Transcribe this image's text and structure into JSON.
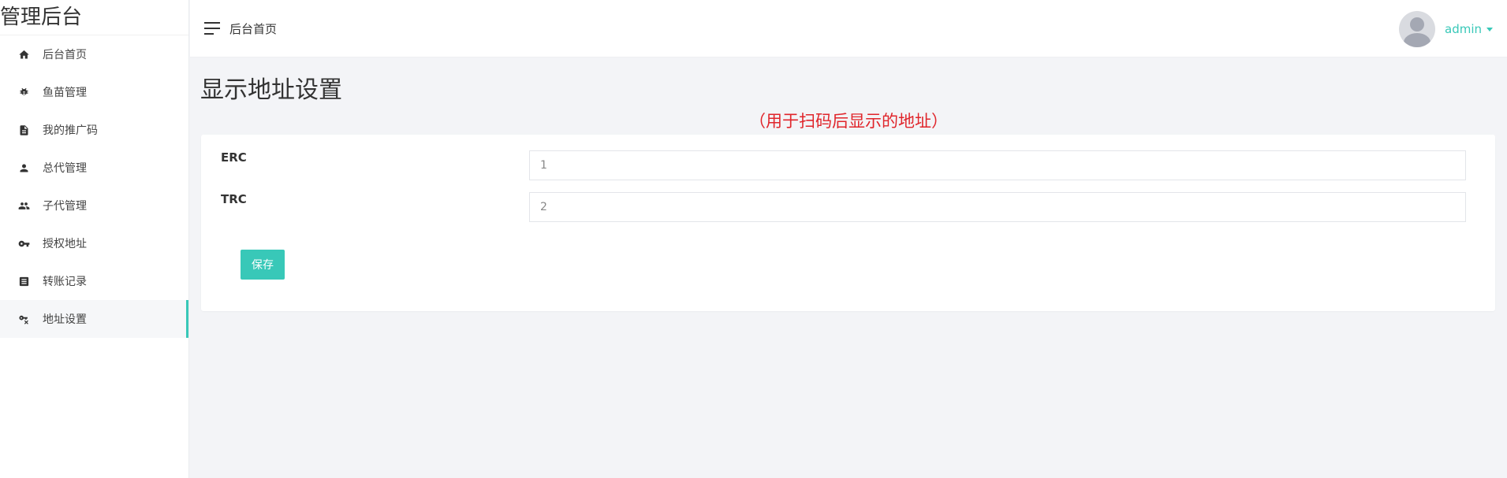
{
  "app": {
    "title": "管理后台"
  },
  "sidebar": {
    "items": [
      {
        "label": "后台首页",
        "icon": "home-icon"
      },
      {
        "label": "鱼苗管理",
        "icon": "bug-icon"
      },
      {
        "label": "我的推广码",
        "icon": "document-icon"
      },
      {
        "label": "总代管理",
        "icon": "person-icon"
      },
      {
        "label": "子代管理",
        "icon": "people-icon"
      },
      {
        "label": "授权地址",
        "icon": "key-icon"
      },
      {
        "label": "转账记录",
        "icon": "list-icon"
      },
      {
        "label": "地址设置",
        "icon": "key-off-icon",
        "active": true
      }
    ]
  },
  "header": {
    "title": "后台首页",
    "user": "admin"
  },
  "page": {
    "title": "显示地址设置",
    "note": "（用于扫码后显示的地址）",
    "fields": [
      {
        "label": "ERC",
        "value": "1"
      },
      {
        "label": "TRC",
        "value": "2"
      }
    ],
    "save_label": "保存"
  },
  "colors": {
    "accent": "#38c8b8",
    "note": "#e0252b"
  }
}
